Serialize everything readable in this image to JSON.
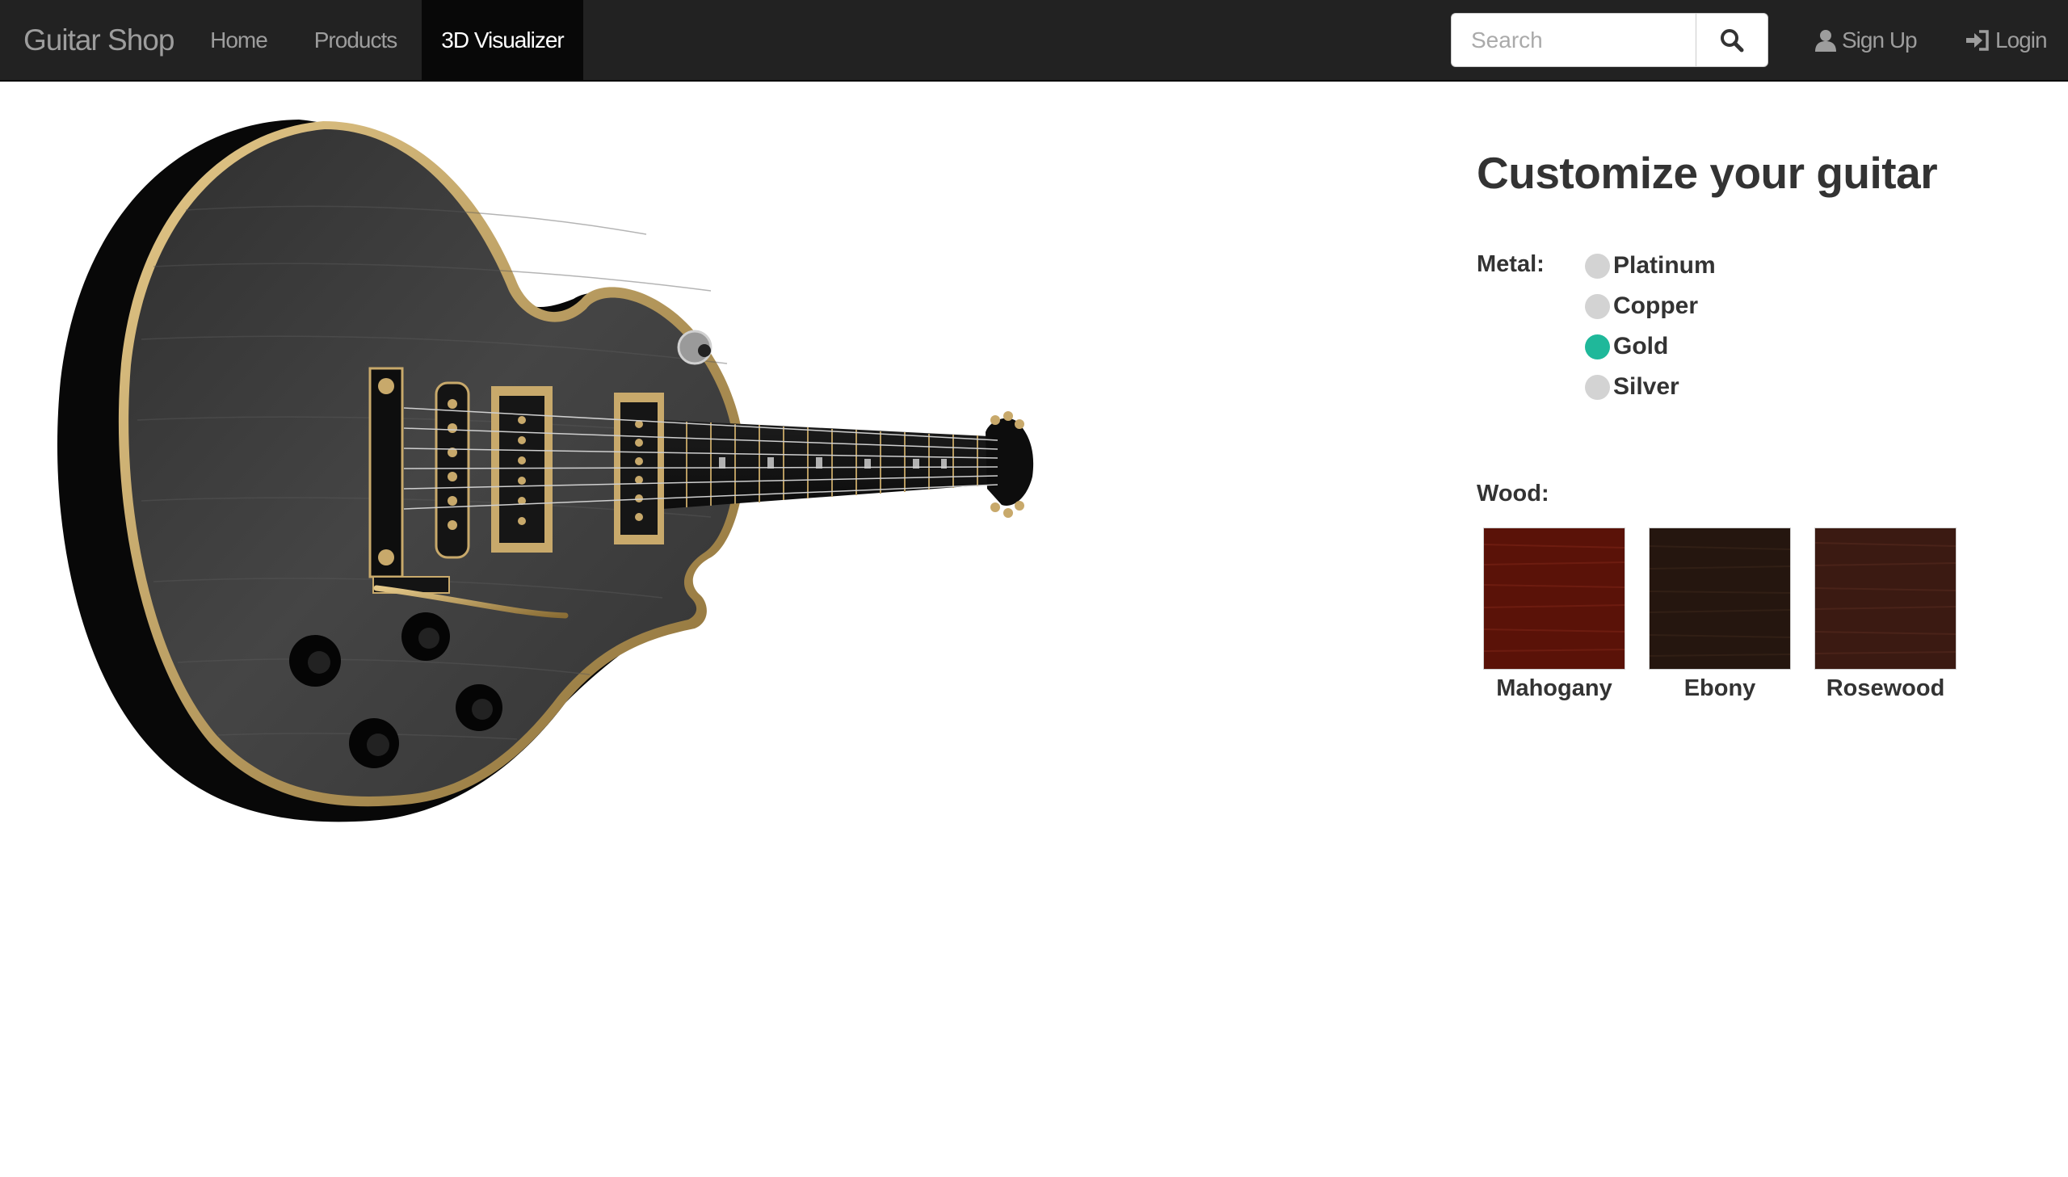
{
  "navbar": {
    "brand": "Guitar Shop",
    "links": [
      {
        "label": "Home",
        "active": false
      },
      {
        "label": "Products",
        "active": false
      },
      {
        "label": "3D Visualizer",
        "active": true
      }
    ],
    "search": {
      "placeholder": "Search",
      "value": "",
      "button_icon": "search-icon"
    },
    "signup": {
      "label": "Sign Up",
      "icon": "user-icon"
    },
    "login": {
      "label": "Login",
      "icon": "log-in-icon"
    }
  },
  "viewer": {
    "model": "electric-guitar",
    "body_finish": "#3a3a3a",
    "binding_color": "#c8a96b"
  },
  "customizer": {
    "title": "Customize your guitar",
    "metal": {
      "label": "Metal:",
      "options": [
        {
          "label": "Platinum",
          "selected": false
        },
        {
          "label": "Copper",
          "selected": false
        },
        {
          "label": "Gold",
          "selected": true
        },
        {
          "label": "Silver",
          "selected": false
        }
      ],
      "selected_color": "#1fb89a",
      "unselected_color": "#d3d3d3"
    },
    "wood": {
      "label": "Wood:",
      "options": [
        {
          "label": "Mahogany",
          "color": "#5a1208"
        },
        {
          "label": "Ebony",
          "color": "#25160f"
        },
        {
          "label": "Rosewood",
          "color": "#3b1a12"
        }
      ]
    }
  }
}
